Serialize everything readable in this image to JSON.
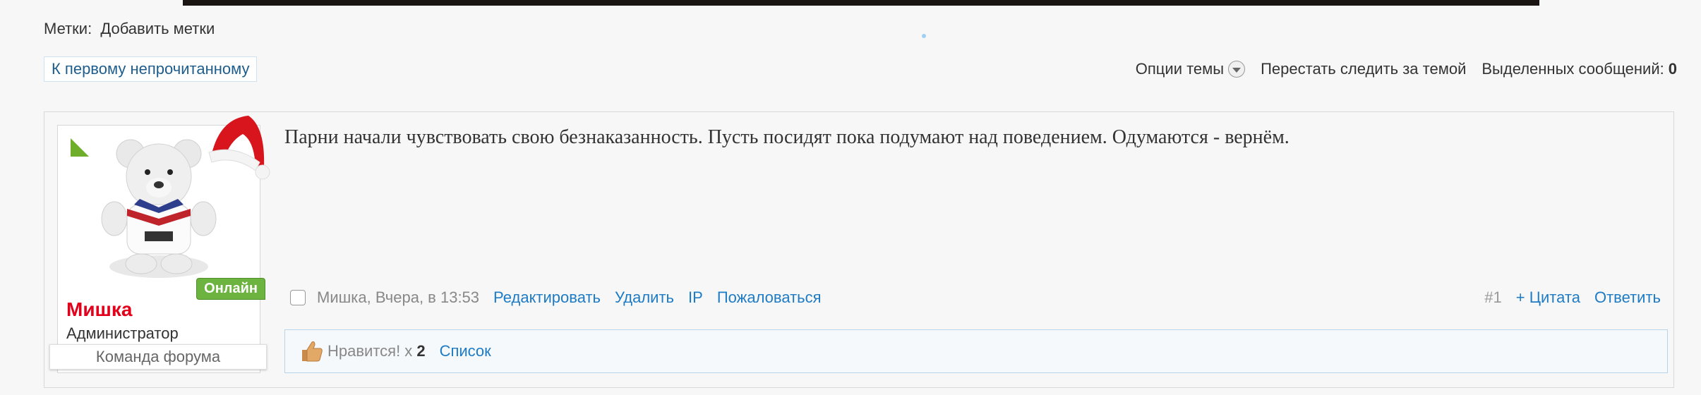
{
  "tags": {
    "label": "Метки:",
    "add_link": "Добавить метки"
  },
  "first_unread_button": "К первому непрочитанному",
  "thread_controls": {
    "options": "Опции темы",
    "unwatch": "Перестать следить за темой",
    "selected_label": "Выделенных сообщений:",
    "selected_count": "0"
  },
  "post": {
    "user": {
      "name": "Мишка",
      "role": "Администратор",
      "team_badge": "Команда форума",
      "online_badge": "Онлайн"
    },
    "message": "Парни начали чувствовать свою безнаказанность. Пусть посидят пока подумают над поведением. Одумаются - вернём.",
    "meta": {
      "author_time": "Мишка, Вчера, в 13:53",
      "actions": [
        "Редактировать",
        "Удалить",
        "IP",
        "Пожаловаться"
      ],
      "post_number": "#1",
      "quote": "+ Цитата",
      "reply": "Ответить"
    },
    "likes": {
      "liked_label": "Нравится! x",
      "count": "2",
      "list_link": "Список"
    }
  },
  "colors": {
    "link": "#1e7bc4",
    "username": "#e2001a",
    "online": "#6cb33f"
  },
  "icons": [
    "chevron-down-icon",
    "santa-hat-icon",
    "teddy-bear-avatar",
    "thumbs-up-icon",
    "checkbox-icon"
  ]
}
